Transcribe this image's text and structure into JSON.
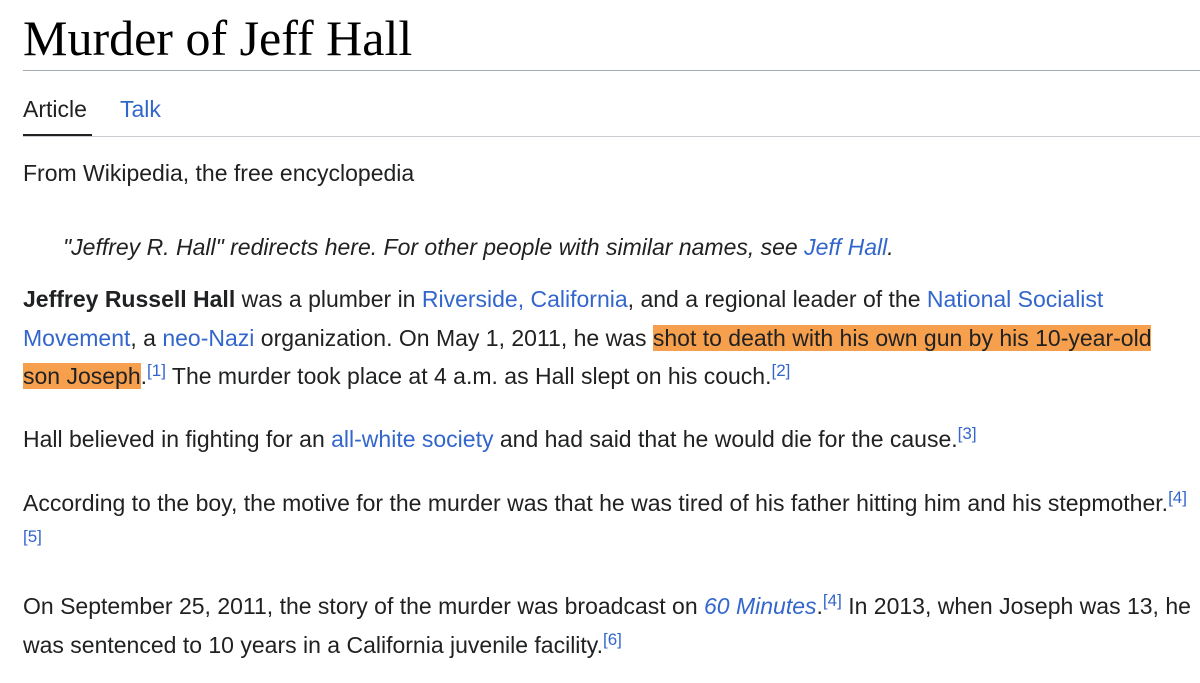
{
  "page": {
    "title": "Murder of Jeff Hall",
    "tabs": {
      "article": "Article",
      "talk": "Talk"
    },
    "tagline": "From Wikipedia, the free encyclopedia"
  },
  "hatnote": {
    "prefix": "\"Jeffrey R. Hall\" redirects here. For other people with similar names, see ",
    "link": "Jeff Hall",
    "suffix": "."
  },
  "paragraphs": {
    "p1": {
      "subject": "Jeffrey Russell Hall",
      "t1": " was a plumber in ",
      "link_riverside": "Riverside, California",
      "t2": ", and a regional leader of the ",
      "link_nsm": "National Socialist Movement",
      "t3": ", a ",
      "link_neonazi": "neo-Nazi",
      "t4": " organization. On May 1, 2011, he was ",
      "highlight": "shot to death with his own gun by his 10-year-old son Joseph",
      "t5": ".",
      "cite1": "[1]",
      "t6": " The murder took place at 4 a.m. as Hall slept on his couch.",
      "cite2": "[2]"
    },
    "p2": {
      "t1": "Hall believed in fighting for an ",
      "link_allwhite": "all-white society",
      "t2": " and had said that he would die for the cause.",
      "cite3": "[3]"
    },
    "p3": {
      "t1": "According to the boy, the motive for the murder was that he was tired of his father hitting him and his stepmother.",
      "cite4": "[4]",
      "cite5": "[5]"
    },
    "p4": {
      "t1": "On September 25, 2011, the story of the murder was broadcast on ",
      "link_60min": "60 Minutes",
      "t2": ".",
      "cite4": "[4]",
      "t3": " In 2013, when Joseph was 13, he was sentenced to 10 years in a California juvenile facility.",
      "cite6": "[6]"
    }
  },
  "colors": {
    "link": "#3366cc",
    "text": "#202122",
    "highlight": "#f6a04d",
    "rule": "#a2a9b1"
  }
}
